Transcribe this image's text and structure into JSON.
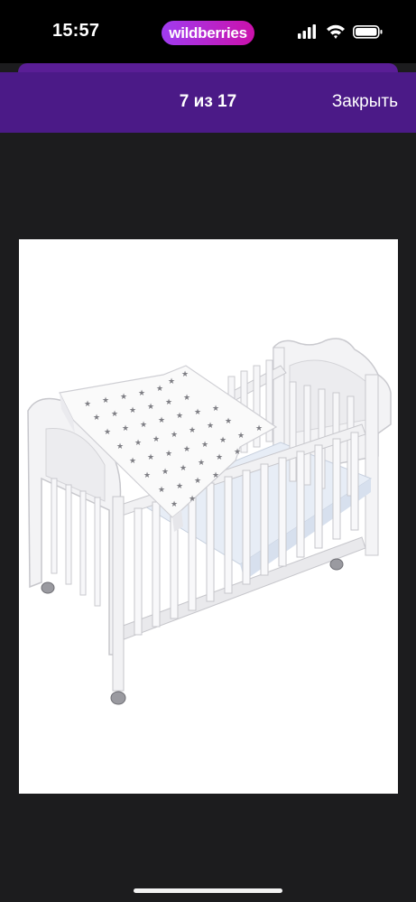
{
  "status_bar": {
    "time": "15:57",
    "app_badge": "wildberries"
  },
  "header": {
    "counter": "7 из 17",
    "close_label": "Закрыть"
  },
  "colors": {
    "header_bg": "#4b1a87",
    "badge_gradient_start": "#a03cf0",
    "badge_gradient_end": "#cb11ab",
    "viewer_bg": "#1c1c1e"
  },
  "icons": [
    "signal-icon",
    "wifi-icon",
    "battery-icon"
  ]
}
